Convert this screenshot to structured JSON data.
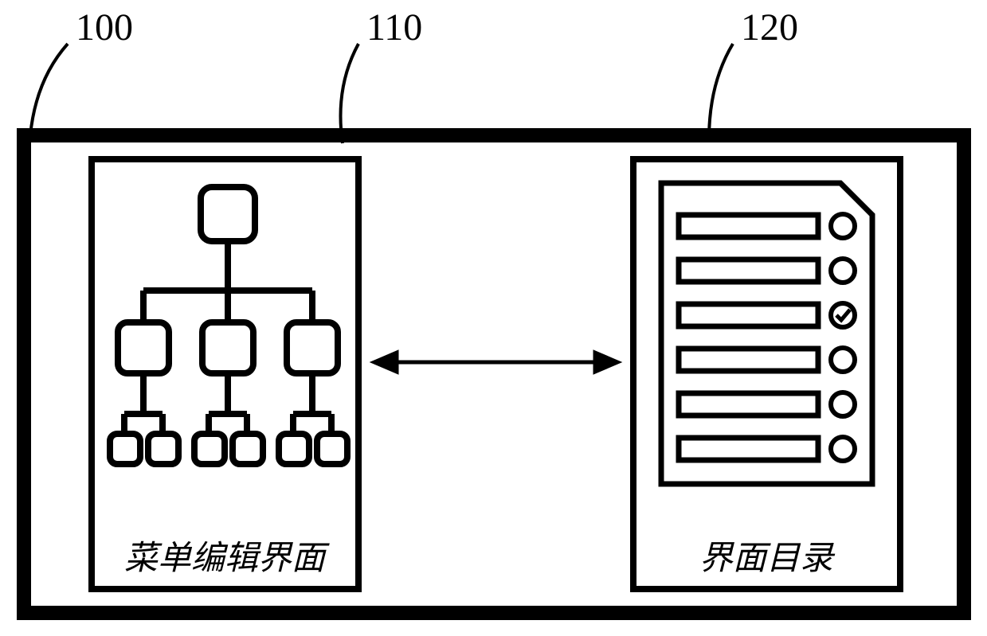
{
  "callouts": {
    "outer": "100",
    "left": "110",
    "right": "120"
  },
  "panels": {
    "left_label": "菜单编辑界面",
    "right_label": "界面目录"
  },
  "directory": {
    "rows": 6,
    "checked_index": 2
  }
}
